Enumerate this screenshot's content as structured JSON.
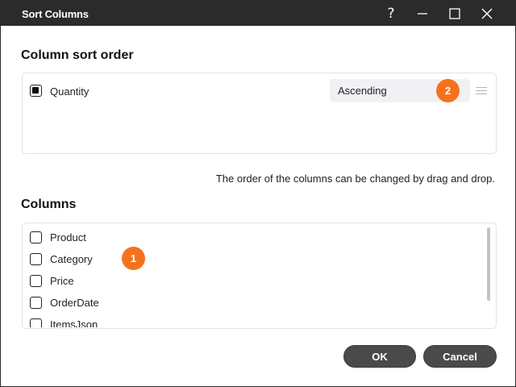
{
  "window": {
    "title": "Sort Columns",
    "help_glyph": "?"
  },
  "sort_order": {
    "heading": "Column sort order",
    "items": [
      {
        "label": "Quantity",
        "checked": true,
        "direction": "Ascending"
      }
    ],
    "badge": "2"
  },
  "hint": "The order of the columns can be changed by drag and drop.",
  "columns": {
    "heading": "Columns",
    "badge": "1",
    "items": [
      {
        "label": "Product",
        "checked": false
      },
      {
        "label": "Category",
        "checked": false
      },
      {
        "label": "Price",
        "checked": false
      },
      {
        "label": "OrderDate",
        "checked": false
      },
      {
        "label": "ItemsJson",
        "checked": false
      }
    ]
  },
  "buttons": {
    "ok": "OK",
    "cancel": "Cancel"
  },
  "colors": {
    "titlebar": "#2b2b2b",
    "badge": "#f5721c",
    "button": "#4a4a4a"
  },
  "icons": [
    "help-icon",
    "minimize-icon",
    "maximize-icon",
    "close-icon",
    "drag-handle-icon"
  ]
}
